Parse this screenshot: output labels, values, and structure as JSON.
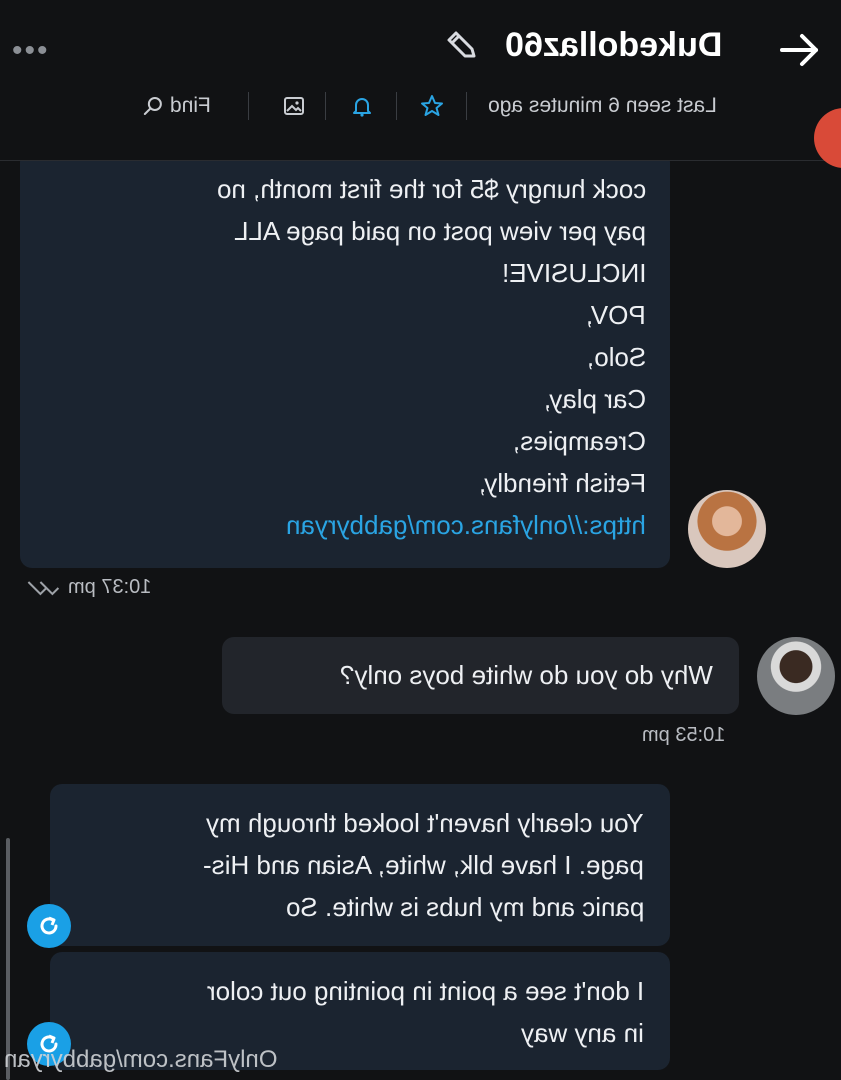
{
  "header": {
    "title": "Dukedollaz60",
    "status": "Last seen 6 minutes ago",
    "find_label": "Find",
    "more": "•••"
  },
  "messages": {
    "m1": {
      "lines": [
        "cock hungry $5 for the first month, no",
        "pay per view post on paid page ALL",
        "INCLUSIVE!",
        "POV,",
        "Solo,",
        "Car play,",
        "Creampies,",
        "Fetish friendly,"
      ],
      "link": "https://onlyfans.com/gabbyryan",
      "time": "10:37 pm"
    },
    "m2": {
      "text": "Why do you do white boys only?",
      "time": "10:53 pm"
    },
    "m3": {
      "lines": [
        "You clearly haven't looked through my",
        "page. I have blk, white, Asian and His-",
        "panic and my hubs is white. So"
      ]
    },
    "m4": {
      "lines": [
        "I don't see a point in pointing out color",
        "in any way"
      ]
    }
  },
  "watermark": "OnlyFans.com/gabbyryan",
  "colors": {
    "accent": "#2aa4e3",
    "incoming_bubble": "#1b2430",
    "outgoing_bubble": "#22252b",
    "badge": "#d94a38"
  }
}
